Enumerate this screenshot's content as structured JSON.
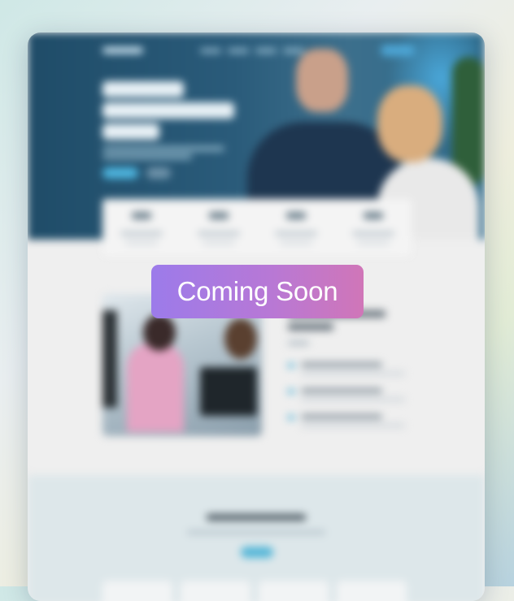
{
  "badge": {
    "label": "Coming Soon"
  },
  "colors": {
    "hero_bg": "#2a5b7a",
    "accent": "#4eb6e0",
    "badge_start": "#9c7bea",
    "badge_end": "#d076b8"
  },
  "preview": {
    "nav_link_count_visible": 4,
    "stat_count": 4,
    "feature_count": 3,
    "bottom_card_count": 4
  }
}
